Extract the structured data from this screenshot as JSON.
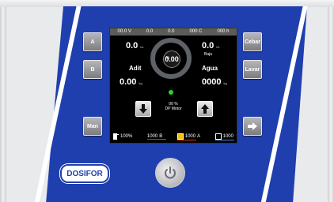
{
  "status": {
    "items": [
      "00.0 V",
      "0.0",
      "0.0",
      "000 C",
      "000 h"
    ]
  },
  "left_buttons": {
    "a": "A",
    "b": "B",
    "man": "Man"
  },
  "right_buttons": {
    "cebar": "Cebar",
    "lavar": "Lavar"
  },
  "screen": {
    "top_left_value": "0.0",
    "top_left_unit": "l/s",
    "top_right_value": "0.0",
    "top_right_unit": "l/s",
    "baja": "Baja",
    "adit_label": "Adit",
    "agua_label": "Agua",
    "adit_value": "0.00",
    "adit_unit": "kg",
    "agua_value": "0000",
    "agua_unit": "kg",
    "center_value": "0.00",
    "center_unit": "%",
    "dp_percent": "00 %",
    "dp_label": "DP Motor"
  },
  "bottom_bar": {
    "fuel": "100%",
    "b_value": "1000",
    "b_letter": "B",
    "a_value": "1000",
    "a_letter": "A",
    "c_value": "1000"
  },
  "brand": "DOSIFOR"
}
